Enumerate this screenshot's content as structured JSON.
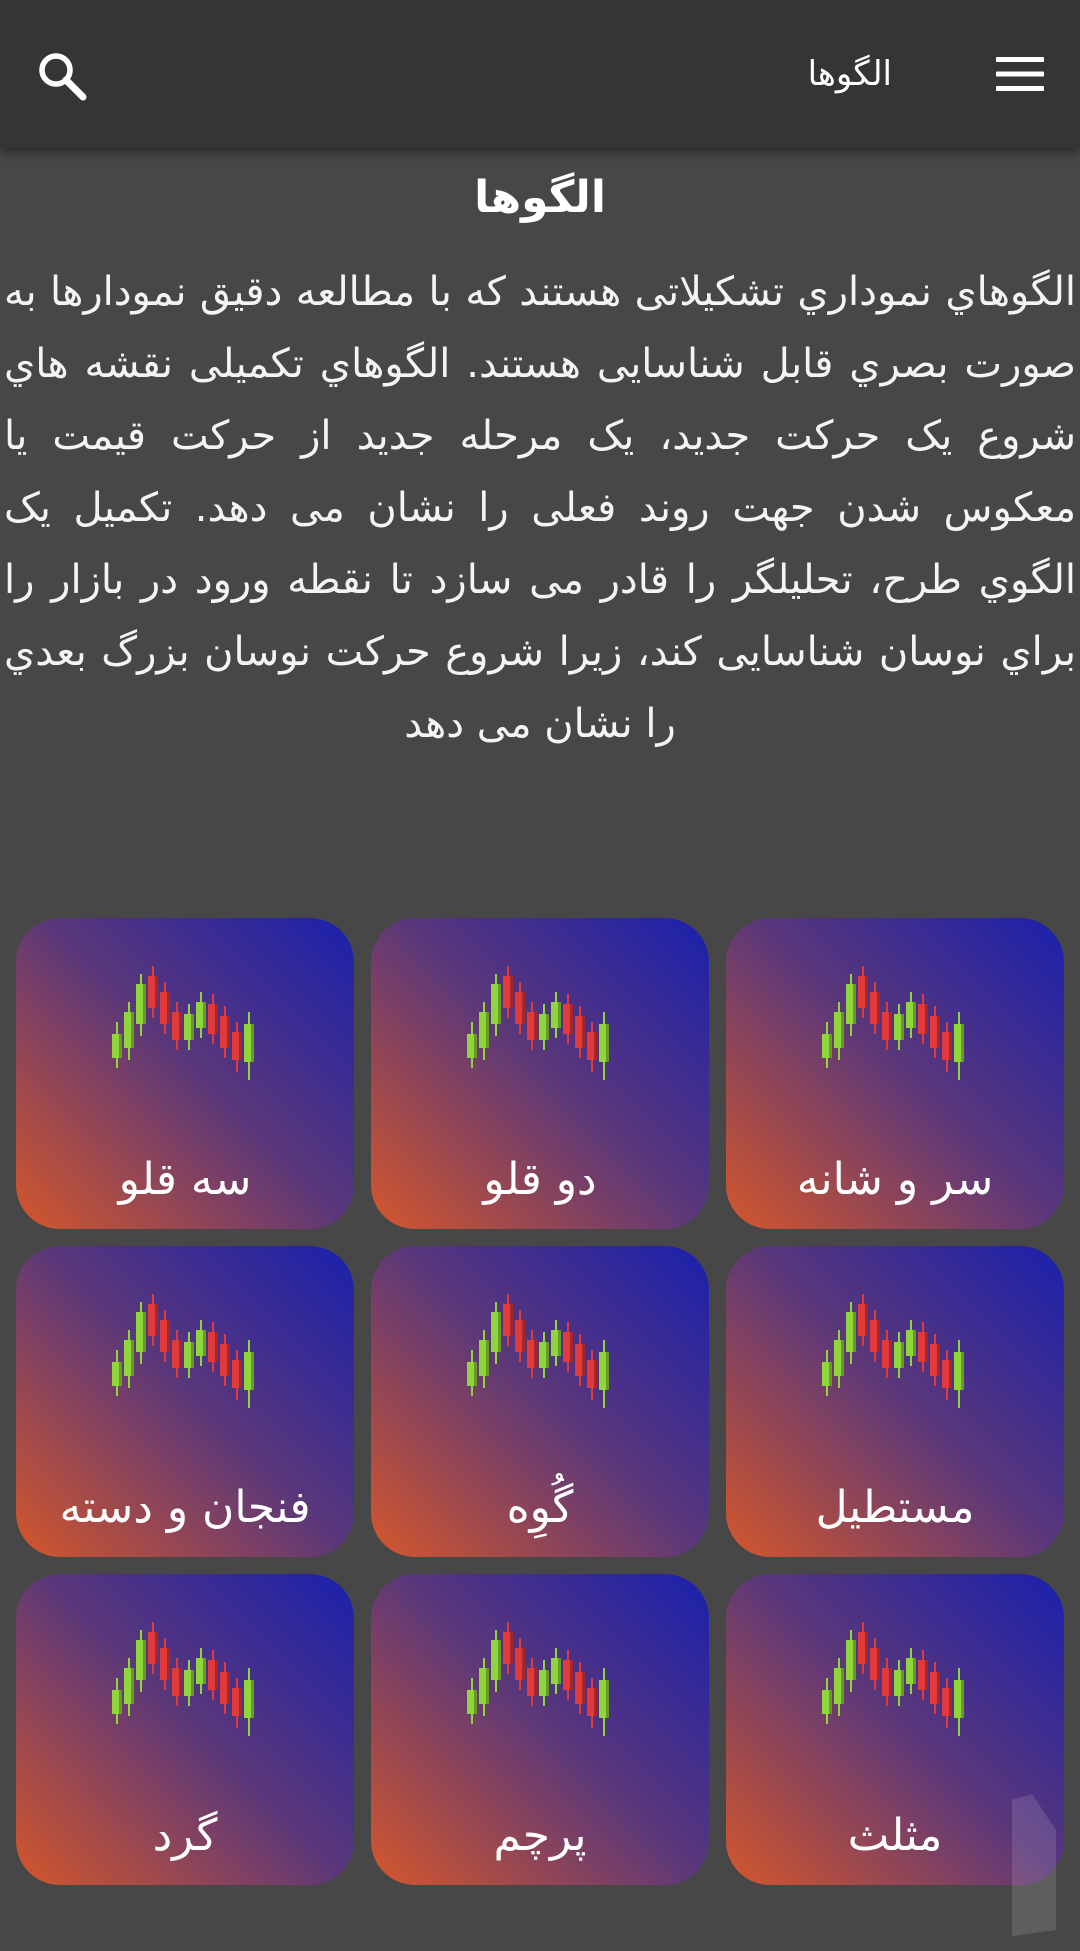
{
  "appbar": {
    "title": "الگوها"
  },
  "content": {
    "heading": "الگوها",
    "intro": "الگوهاي نموداري تشکيلاتی هستند که با مطالعه دقيق نمودارها به صورت بصري قابل شناسايی هستند. الگوهاي تکميلی نقشه هاي شروع يک حرکت جديد، يک مرحله جديد از حرکت قيمت يا معکوس شدن جهت روند فعلی را نشان می دهد. تکميل يک الگوي طرح، تحليلگر را قادر می سازد تا نقطه ورود در بازار را براي نوسان شناسايی کند، زيرا شروع حرکت نوسان بزرگ بعدي را نشان می دهد"
  },
  "patterns": [
    {
      "label": "سر و شانه"
    },
    {
      "label": "دو قلو"
    },
    {
      "label": "سه قلو"
    },
    {
      "label": "مستطيل"
    },
    {
      "label": "گُوِه"
    },
    {
      "label": "فنجان و دسته"
    },
    {
      "label": "مثلث"
    },
    {
      "label": "پرچم"
    },
    {
      "label": "گرد"
    }
  ],
  "icons": {
    "menu": "hamburger-menu-icon",
    "search": "search-icon",
    "card": "candlestick-chart-icon"
  },
  "colors": {
    "background": "#474747",
    "appbar": "#353535",
    "card_gradient_start": "#1a20ad",
    "card_gradient_mid": "#5a377a",
    "card_gradient_end": "#d4572b",
    "candle_green": "#8fd63a",
    "candle_red": "#e23a3a"
  }
}
